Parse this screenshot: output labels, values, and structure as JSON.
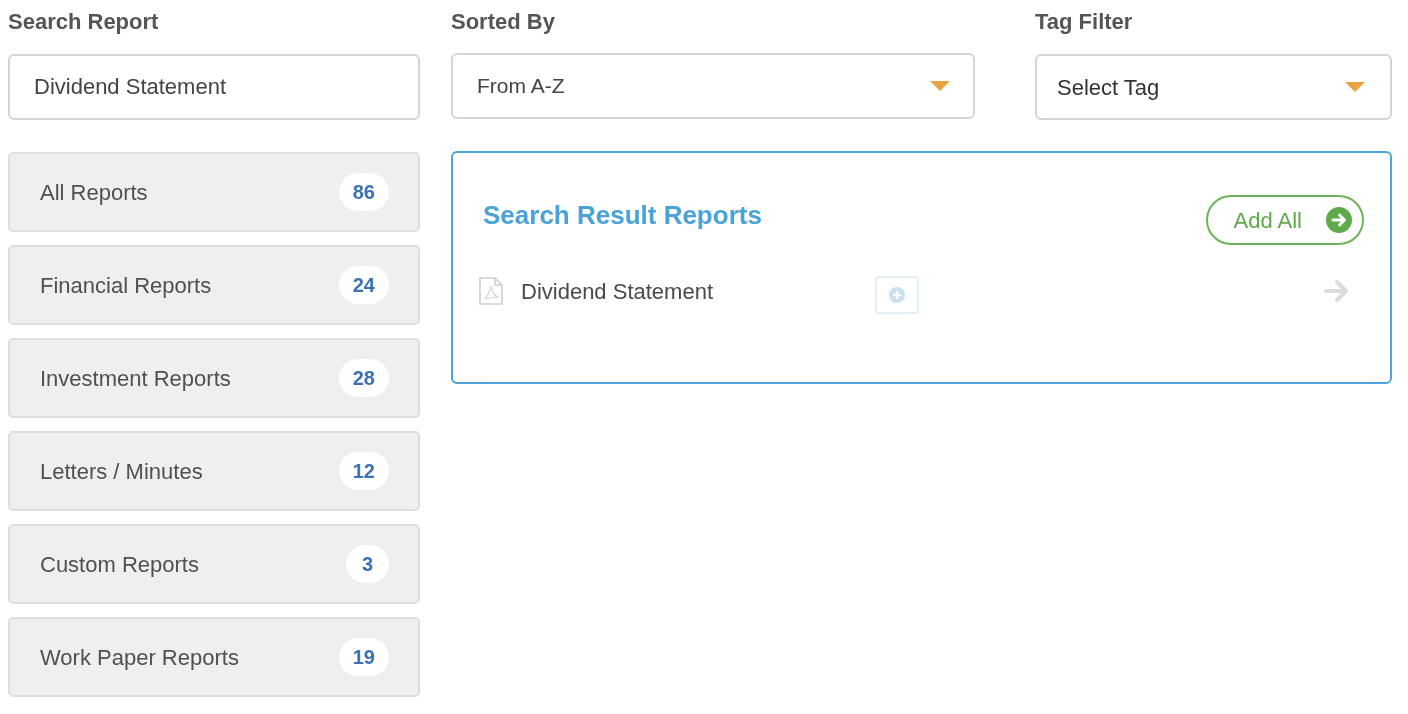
{
  "search": {
    "label": "Search Report",
    "value": "Dividend Statement"
  },
  "sort": {
    "label": "Sorted By",
    "value": "From A-Z"
  },
  "tag_filter": {
    "label": "Tag Filter",
    "value": "Select Tag"
  },
  "categories": [
    {
      "label": "All Reports",
      "count": "86"
    },
    {
      "label": "Financial Reports",
      "count": "24"
    },
    {
      "label": "Investment Reports",
      "count": "28"
    },
    {
      "label": "Letters / Minutes",
      "count": "12"
    },
    {
      "label": "Custom Reports",
      "count": "3"
    },
    {
      "label": "Work Paper Reports",
      "count": "19"
    }
  ],
  "results": {
    "title": "Search Result Reports",
    "add_all": "Add All",
    "items": [
      {
        "name": "Dividend Statement"
      }
    ]
  }
}
